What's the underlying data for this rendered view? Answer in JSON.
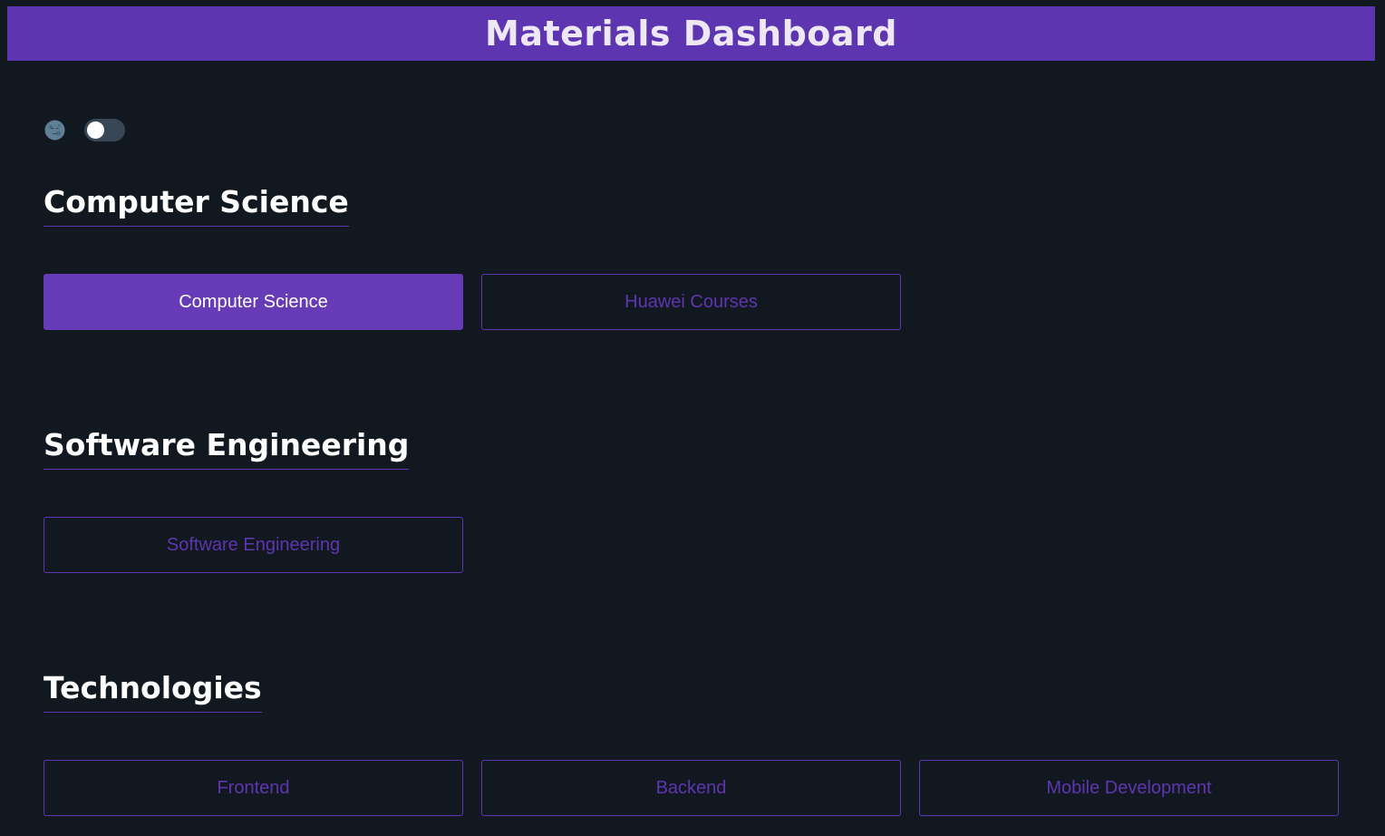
{
  "header": {
    "title": "Materials Dashboard"
  },
  "theme_toggle": {
    "icon": "moon-icon",
    "state": "off"
  },
  "colors": {
    "background": "#121820",
    "accent": "#5e35b1",
    "active_button": "#673ab7",
    "text_light": "#ffffff"
  },
  "sections": [
    {
      "title": "Computer Science",
      "buttons": [
        {
          "label": "Computer Science",
          "active": true
        },
        {
          "label": "Huawei Courses",
          "active": false
        }
      ]
    },
    {
      "title": "Software Engineering",
      "buttons": [
        {
          "label": "Software Engineering",
          "active": false
        }
      ]
    },
    {
      "title": "Technologies",
      "buttons": [
        {
          "label": "Frontend",
          "active": false
        },
        {
          "label": "Backend",
          "active": false
        },
        {
          "label": "Mobile Development",
          "active": false
        }
      ]
    }
  ]
}
